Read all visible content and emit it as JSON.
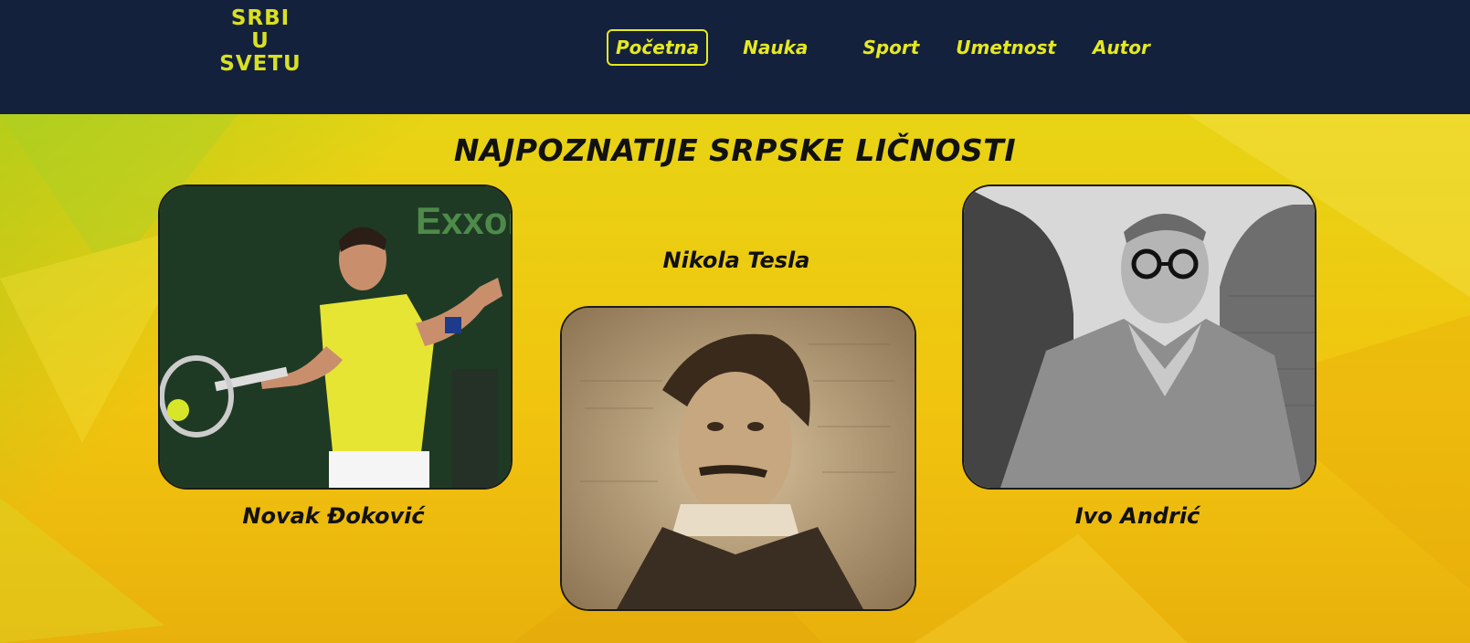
{
  "header": {
    "logo_line1": "SRBI",
    "logo_line2": "U",
    "logo_line3": "SVETU",
    "nav": [
      {
        "label": "Početna",
        "active": true
      },
      {
        "label": "Nauka"
      },
      {
        "label": "Sport"
      },
      {
        "label": "Umetnost"
      },
      {
        "label": "Autor"
      }
    ]
  },
  "main": {
    "title": "NAJPOZNATIJE SRPSKE LIČNOSTI",
    "persons": [
      {
        "name": "Novak Đoković"
      },
      {
        "name": "Nikola Tesla"
      },
      {
        "name": "Ivo Andrić"
      }
    ],
    "sponsor_text": "Exxon"
  },
  "colors": {
    "header_bg": "#14213d",
    "accent": "#e6e91f",
    "page_bg": "#f1c40f"
  }
}
